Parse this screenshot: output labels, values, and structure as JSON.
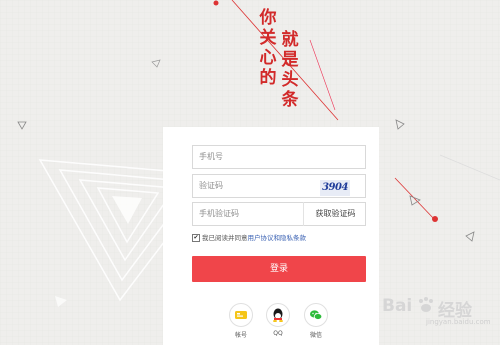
{
  "slogan": {
    "left_column": [
      "你",
      "关",
      "心",
      "的"
    ],
    "right_column": [
      "就",
      "是",
      "头",
      "条"
    ]
  },
  "form": {
    "phone_placeholder": "手机号",
    "captcha_placeholder": "验证码",
    "captcha_image_text": "3904",
    "sms_code_placeholder": "手机验证码",
    "get_sms_code_label": "获取验证码",
    "agree_prefix": "我已阅读并同意",
    "agree_link": "用户协议和隐私条款",
    "login_label": "登录"
  },
  "social": [
    {
      "label": "帐号",
      "icon": "account-icon",
      "color": "#f5c518"
    },
    {
      "label": "QQ",
      "icon": "qq-icon",
      "color": "#1e90e6"
    },
    {
      "label": "微信",
      "icon": "wechat-icon",
      "color": "#2dbb3a"
    }
  ],
  "watermark": {
    "brand": "Bai",
    "paw": "paw-icon",
    "brand2": "经验",
    "url": "jingyan.baidu.com"
  },
  "colors": {
    "accent": "#f0454a",
    "slogan": "#d22a2a",
    "link": "#3b62b3"
  }
}
